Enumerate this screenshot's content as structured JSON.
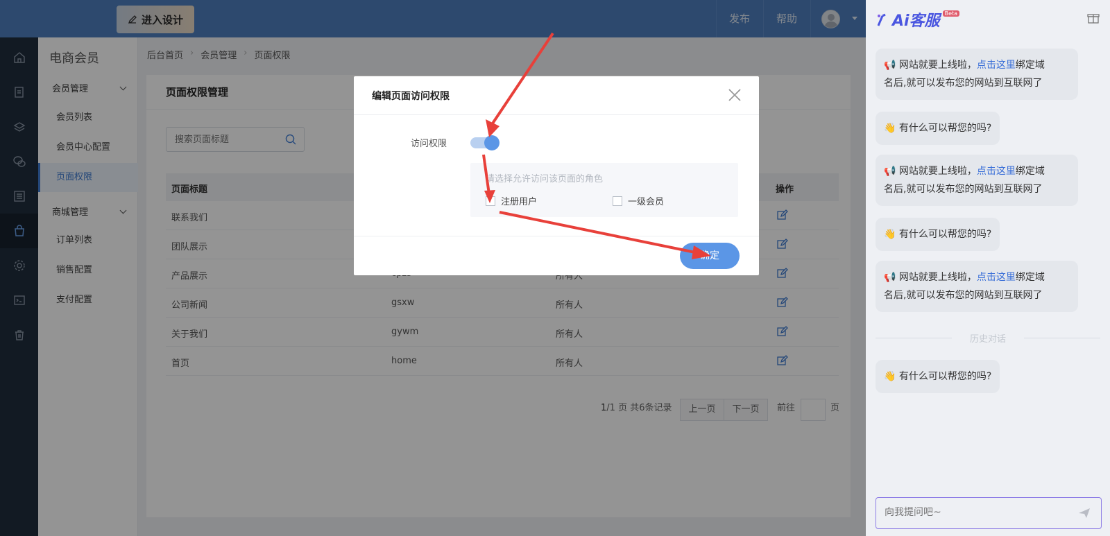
{
  "topbar": {
    "design_btn": "进入设计",
    "publish": "发布",
    "help": "帮助"
  },
  "submenu": {
    "title": "电商会员",
    "groups": [
      {
        "label": "会员管理",
        "items": [
          "会员列表",
          "会员中心配置",
          "页面权限"
        ]
      },
      {
        "label": "商城管理",
        "items": [
          "订单列表",
          "销售配置",
          "支付配置"
        ]
      }
    ],
    "active": "页面权限"
  },
  "breadcrumb": [
    "后台首页",
    "会员管理",
    "页面权限"
  ],
  "card": {
    "title": "页面权限管理",
    "search_placeholder": "搜索页面标题",
    "columns": [
      "页面标题",
      "操作"
    ],
    "rows": [
      {
        "title": "联系我们",
        "code": "",
        "access": ""
      },
      {
        "title": "团队展示",
        "code": "",
        "access": ""
      },
      {
        "title": "产品展示",
        "code": "cpzs",
        "access": "所有人"
      },
      {
        "title": "公司新闻",
        "code": "gsxw",
        "access": "所有人"
      },
      {
        "title": "关于我们",
        "code": "gywm",
        "access": "所有人"
      },
      {
        "title": "首页",
        "code": "home",
        "access": "所有人"
      }
    ],
    "pager": {
      "page_current": "1",
      "page_total_text": "/1 页 共6条记录",
      "prev": "上一页",
      "next": "下一页",
      "goto": "前往",
      "page_unit": "页"
    }
  },
  "modal": {
    "title": "编辑页面访问权限",
    "perm_label": "访问权限",
    "switch_on": true,
    "role_hint": "请选择允许访问该页面的角色",
    "roles": [
      "注册用户",
      "一级会员"
    ],
    "confirm": "确定"
  },
  "ai": {
    "logo": "Ai客服",
    "beta": "Beta",
    "msg_a_pre": "📢 网站就要上线啦，",
    "msg_a_link": "点击这里",
    "msg_a_post1": "绑定域",
    "msg_a_post2": "名后,就可以发布您的网站到互联网了",
    "msg_b": "👋 有什么可以帮您的吗?",
    "history": "历史对话",
    "input_placeholder": "向我提问吧~"
  },
  "colors": {
    "topbar": "#4f7ebd",
    "rail": "#1f2d3d",
    "accent": "#5b96e6",
    "ai_brand": "#4a56e0"
  }
}
